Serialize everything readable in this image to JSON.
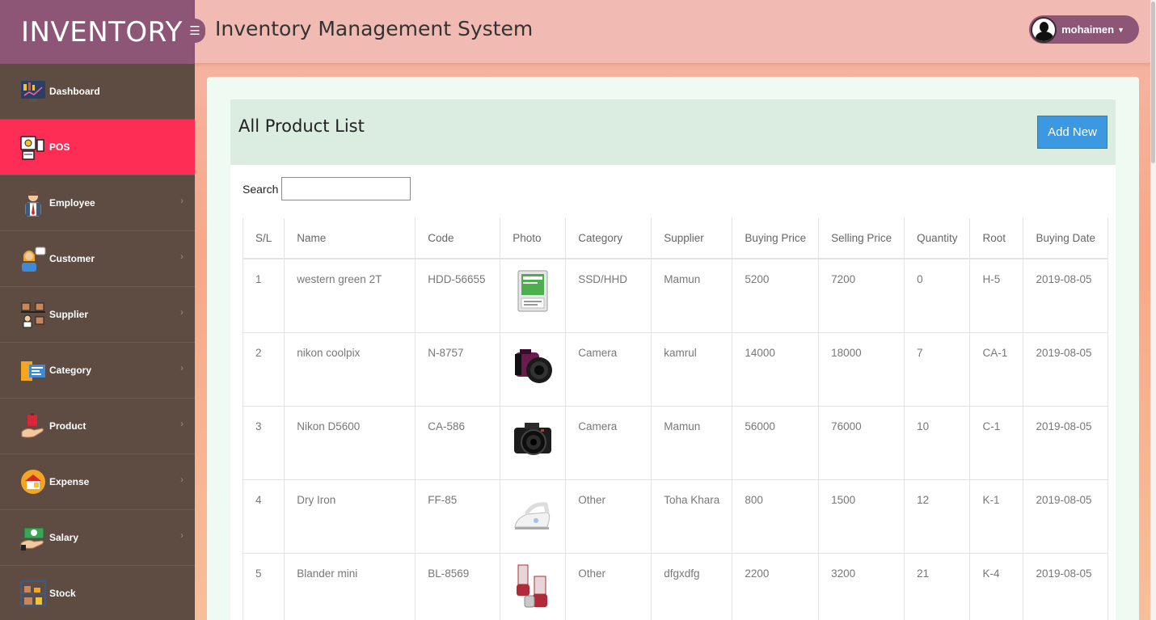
{
  "brand": "INVENTORY",
  "app_title": "Inventory Management System",
  "user": {
    "name": "mohaimen"
  },
  "sidebar": {
    "items": [
      {
        "label": "Dashboard",
        "icon": "dashboard-icon",
        "active": false,
        "chevron": false
      },
      {
        "label": "POS",
        "icon": "pos-icon",
        "active": true,
        "chevron": false
      },
      {
        "label": "Employee",
        "icon": "employee-icon",
        "active": false,
        "chevron": true
      },
      {
        "label": "Customer",
        "icon": "customer-icon",
        "active": false,
        "chevron": true
      },
      {
        "label": "Supplier",
        "icon": "supplier-icon",
        "active": false,
        "chevron": true
      },
      {
        "label": "Category",
        "icon": "category-icon",
        "active": false,
        "chevron": true
      },
      {
        "label": "Product",
        "icon": "product-icon",
        "active": false,
        "chevron": true
      },
      {
        "label": "Expense",
        "icon": "expense-icon",
        "active": false,
        "chevron": true
      },
      {
        "label": "Salary",
        "icon": "salary-icon",
        "active": false,
        "chevron": true
      },
      {
        "label": "Stock",
        "icon": "stock-icon",
        "active": false,
        "chevron": false
      }
    ]
  },
  "main": {
    "title": "All Product List",
    "add_button": "Add New",
    "search": {
      "label": "Search",
      "value": "",
      "placeholder": ""
    },
    "table": {
      "columns": [
        "S/L",
        "Name",
        "Code",
        "Photo",
        "Category",
        "Supplier",
        "Buying Price",
        "Selling Price",
        "Quantity",
        "Root",
        "Buying Date"
      ],
      "rows": [
        {
          "sl": "1",
          "name": "western green 2T",
          "code": "HDD-56655",
          "photo": "hard-drive-photo",
          "category": "SSD/HHD",
          "supplier": "Mamun",
          "buying_price": "5200",
          "selling_price": "7200",
          "quantity": "0",
          "root": "H-5",
          "buying_date": "2019-08-05"
        },
        {
          "sl": "2",
          "name": "nikon coolpix",
          "code": "N-8757",
          "photo": "purple-camera-photo",
          "category": "Camera",
          "supplier": "kamrul",
          "buying_price": "14000",
          "selling_price": "18000",
          "quantity": "7",
          "root": "CA-1",
          "buying_date": "2019-08-05"
        },
        {
          "sl": "3",
          "name": "Nikon D5600",
          "code": "CA-586",
          "photo": "dslr-camera-photo",
          "category": "Camera",
          "supplier": "Mamun",
          "buying_price": "56000",
          "selling_price": "76000",
          "quantity": "10",
          "root": "C-1",
          "buying_date": "2019-08-05"
        },
        {
          "sl": "4",
          "name": "Dry Iron",
          "code": "FF-85",
          "photo": "iron-photo",
          "category": "Other",
          "supplier": "Toha Khara",
          "buying_price": "800",
          "selling_price": "1500",
          "quantity": "12",
          "root": "K-1",
          "buying_date": "2019-08-05"
        },
        {
          "sl": "5",
          "name": "Blander mini",
          "code": "BL-8569",
          "photo": "blender-photo",
          "category": "Other",
          "supplier": "dfgxdfg",
          "buying_price": "2200",
          "selling_price": "3200",
          "quantity": "21",
          "root": "K-4",
          "buying_date": "2019-08-05"
        }
      ]
    }
  },
  "colors": {
    "brand_bg": "#8d5677",
    "sidebar_bg": "#5e4c43",
    "active_item": "#fe2d55",
    "button_blue": "#3c98e0"
  }
}
